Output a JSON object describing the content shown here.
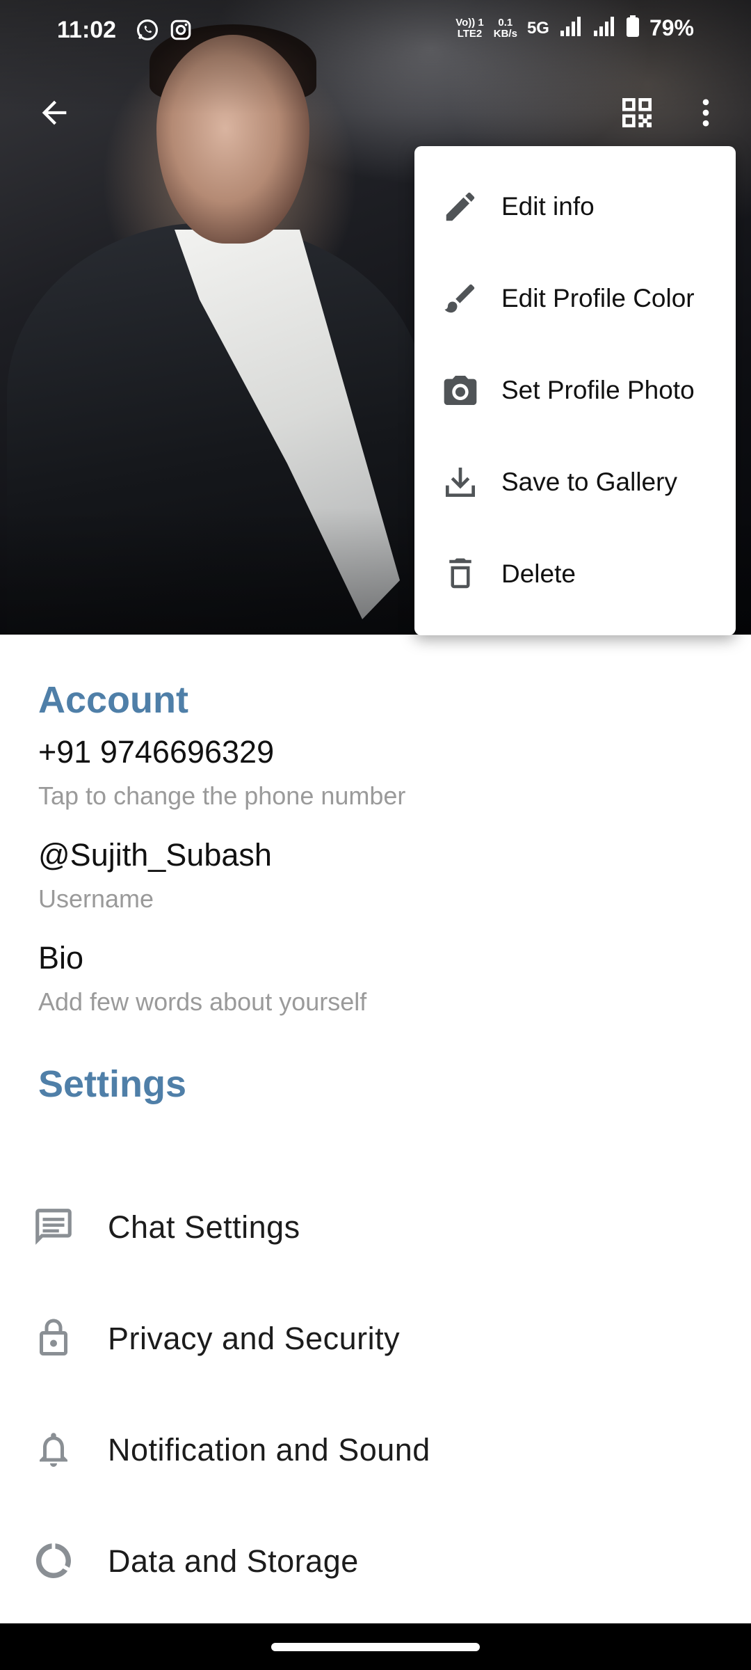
{
  "status_bar": {
    "time": "11:02",
    "volte_line1": "Vo)) 1",
    "volte_line2": "LTE2",
    "speed_line1": "0.1",
    "speed_line2": "KB/s",
    "network": "5G",
    "battery": "79%",
    "app_icons": [
      "whatsapp-icon",
      "instagram-icon"
    ]
  },
  "toolbar": {
    "back_icon": "arrow-left-icon",
    "qr_icon": "qr-code-icon",
    "more_icon": "more-vert-icon"
  },
  "menu": {
    "items": [
      {
        "label": "Edit info",
        "icon": "pencil-icon"
      },
      {
        "label": "Edit Profile Color",
        "icon": "brush-icon"
      },
      {
        "label": "Set Profile Photo",
        "icon": "camera-icon"
      },
      {
        "label": "Save to Gallery",
        "icon": "download-icon"
      },
      {
        "label": "Delete",
        "icon": "trash-icon"
      }
    ]
  },
  "account": {
    "title": "Account",
    "phone": "+91 9746696329",
    "phone_hint": "Tap to change the phone number",
    "username": "@Sujith_Subash",
    "username_hint": "Username",
    "bio": "Bio",
    "bio_hint": "Add few words about yourself"
  },
  "settings": {
    "title": "Settings",
    "items": [
      {
        "label": "Chat Settings",
        "icon": "chat-icon"
      },
      {
        "label": "Privacy and Security",
        "icon": "lock-icon"
      },
      {
        "label": "Notification and Sound",
        "icon": "bell-icon"
      },
      {
        "label": "Data and Storage",
        "icon": "data-usage-icon"
      }
    ]
  },
  "colors": {
    "accent": "#4f7fa8",
    "hint": "#9a9a9a",
    "icon_gray": "#8a8f94"
  }
}
